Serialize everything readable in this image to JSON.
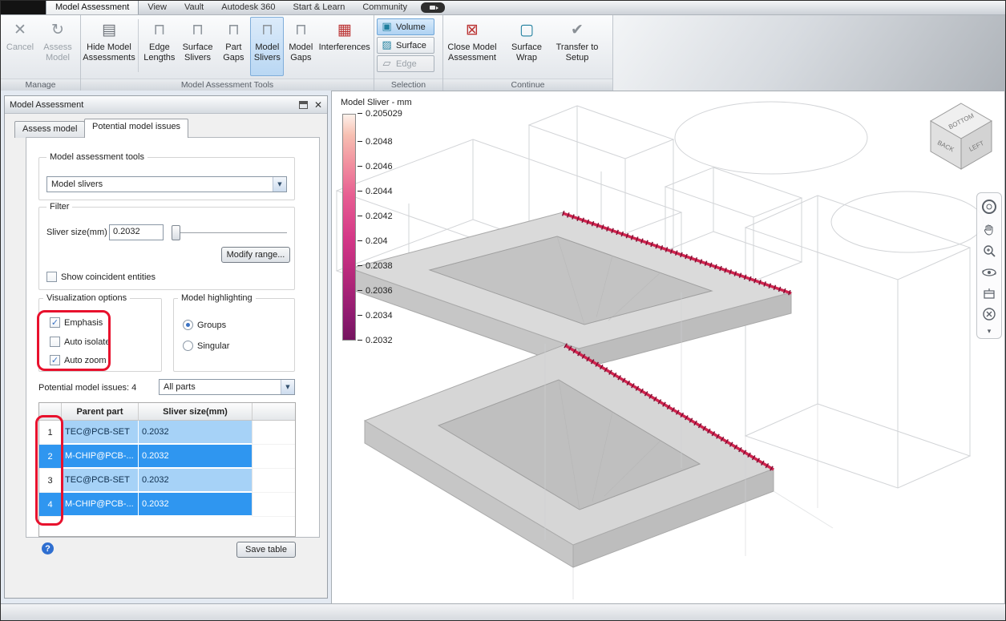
{
  "window": {
    "title": "Model Assessment"
  },
  "icons": {
    "cancel": "✕",
    "assess_model": "↻",
    "hide_model_assessments": "▤",
    "tool_bracket": "⊓",
    "interferences": "▦",
    "volume": "▣",
    "surface": "▨",
    "edge": "▱",
    "close_model_assessment": "⊠",
    "surface_wrap": "▢",
    "transfer_to_setup": "✔",
    "combo_arrow": "▼",
    "check": "✓",
    "panel_close": "✕",
    "help": "?",
    "navbar_chevron": "▾"
  },
  "ribbon": {
    "tabs": [
      {
        "label": "Model Assessment",
        "active": true
      },
      {
        "label": "View",
        "active": false
      },
      {
        "label": "Vault",
        "active": false
      },
      {
        "label": "Autodesk 360",
        "active": false
      },
      {
        "label": "Start & Learn",
        "active": false
      },
      {
        "label": "Community",
        "active": false
      }
    ],
    "groups": [
      {
        "label": "Manage"
      },
      {
        "label": "Model Assessment Tools"
      },
      {
        "label": "Selection"
      },
      {
        "label": "Continue"
      }
    ],
    "buttons": {
      "cancel": "Cancel",
      "assess_model": "Assess Model",
      "hide_model_assessments": "Hide Model Assessments",
      "edge_lengths": "Edge Lengths",
      "surface_slivers": "Surface Slivers",
      "part_gaps": "Part Gaps",
      "model_slivers": "Model Slivers",
      "model_gaps": "Model Gaps",
      "interferences": "Interferences",
      "volume": "Volume",
      "surface": "Surface",
      "edge": "Edge",
      "close_model_assessment": "Close Model Assessment",
      "surface_wrap": "Surface Wrap",
      "transfer_to_setup": "Transfer to Setup"
    },
    "states": {
      "cancel_disabled": true,
      "assess_model_disabled": true,
      "model_slivers_selected": true,
      "volume_selected": true,
      "edge_disabled": true
    }
  },
  "panel": {
    "title": "Model Assessment",
    "tabs": {
      "assess": "Assess model",
      "issues": "Potential model issues",
      "active": "Potential model issues"
    },
    "tools_group": {
      "label": "Model assessment tools",
      "dropdown_value": "Model slivers"
    },
    "filter_group": {
      "label": "Filter",
      "sliver_size_label": "Sliver size(mm)",
      "sliver_size_value": "0.2032",
      "modify_range_button": "Modify range...",
      "show_coincident_label": "Show coincident entities",
      "show_coincident_checked": false
    },
    "visualization_group": {
      "label": "Visualization options",
      "options": [
        {
          "label": "Emphasis",
          "checked": true
        },
        {
          "label": "Auto isolate",
          "checked": false
        },
        {
          "label": "Auto zoom",
          "checked": true
        }
      ]
    },
    "highlighting_group": {
      "label": "Model highlighting",
      "options": [
        {
          "label": "Groups",
          "selected": true
        },
        {
          "label": "Singular",
          "selected": false
        }
      ]
    },
    "issues_label": "Potential model issues: 4",
    "issues_count": 4,
    "parts_dropdown_value": "All parts",
    "table": {
      "headers": [
        "Parent part",
        "Sliver size(mm)"
      ],
      "rows": [
        {
          "num": "1",
          "parent": "TEC@PCB-SET",
          "sliver": "0.2032",
          "highlight": "light"
        },
        {
          "num": "2",
          "parent": "M-CHIP@PCB-...",
          "sliver": "0.2032",
          "highlight": "dark"
        },
        {
          "num": "3",
          "parent": "TEC@PCB-SET",
          "sliver": "0.2032",
          "highlight": "light"
        },
        {
          "num": "4",
          "parent": "M-CHIP@PCB-...",
          "sliver": "0.2032",
          "highlight": "dark"
        }
      ]
    },
    "save_table_button": "Save table"
  },
  "viewport": {
    "legend": {
      "title": "Model Sliver - mm",
      "ticks": [
        "0.205029",
        "0.2048",
        "0.2046",
        "0.2044",
        "0.2042",
        "0.204",
        "0.2038",
        "0.2036",
        "0.2034",
        "0.2032"
      ],
      "gradient_top": "#fdf1ea",
      "gradient_bottom": "#75145f"
    },
    "viewcube": {
      "back": "BACK",
      "bottom": "BOTTOM",
      "left": "LEFT"
    }
  },
  "colors": {
    "selection_blue": "#b9d7f3",
    "row_light": "#a6d2f7",
    "row_dark": "#2f96f0",
    "annotation_red": "#e8112d",
    "sliver_red": "#d2244e",
    "plate_gray": "#dadada"
  }
}
